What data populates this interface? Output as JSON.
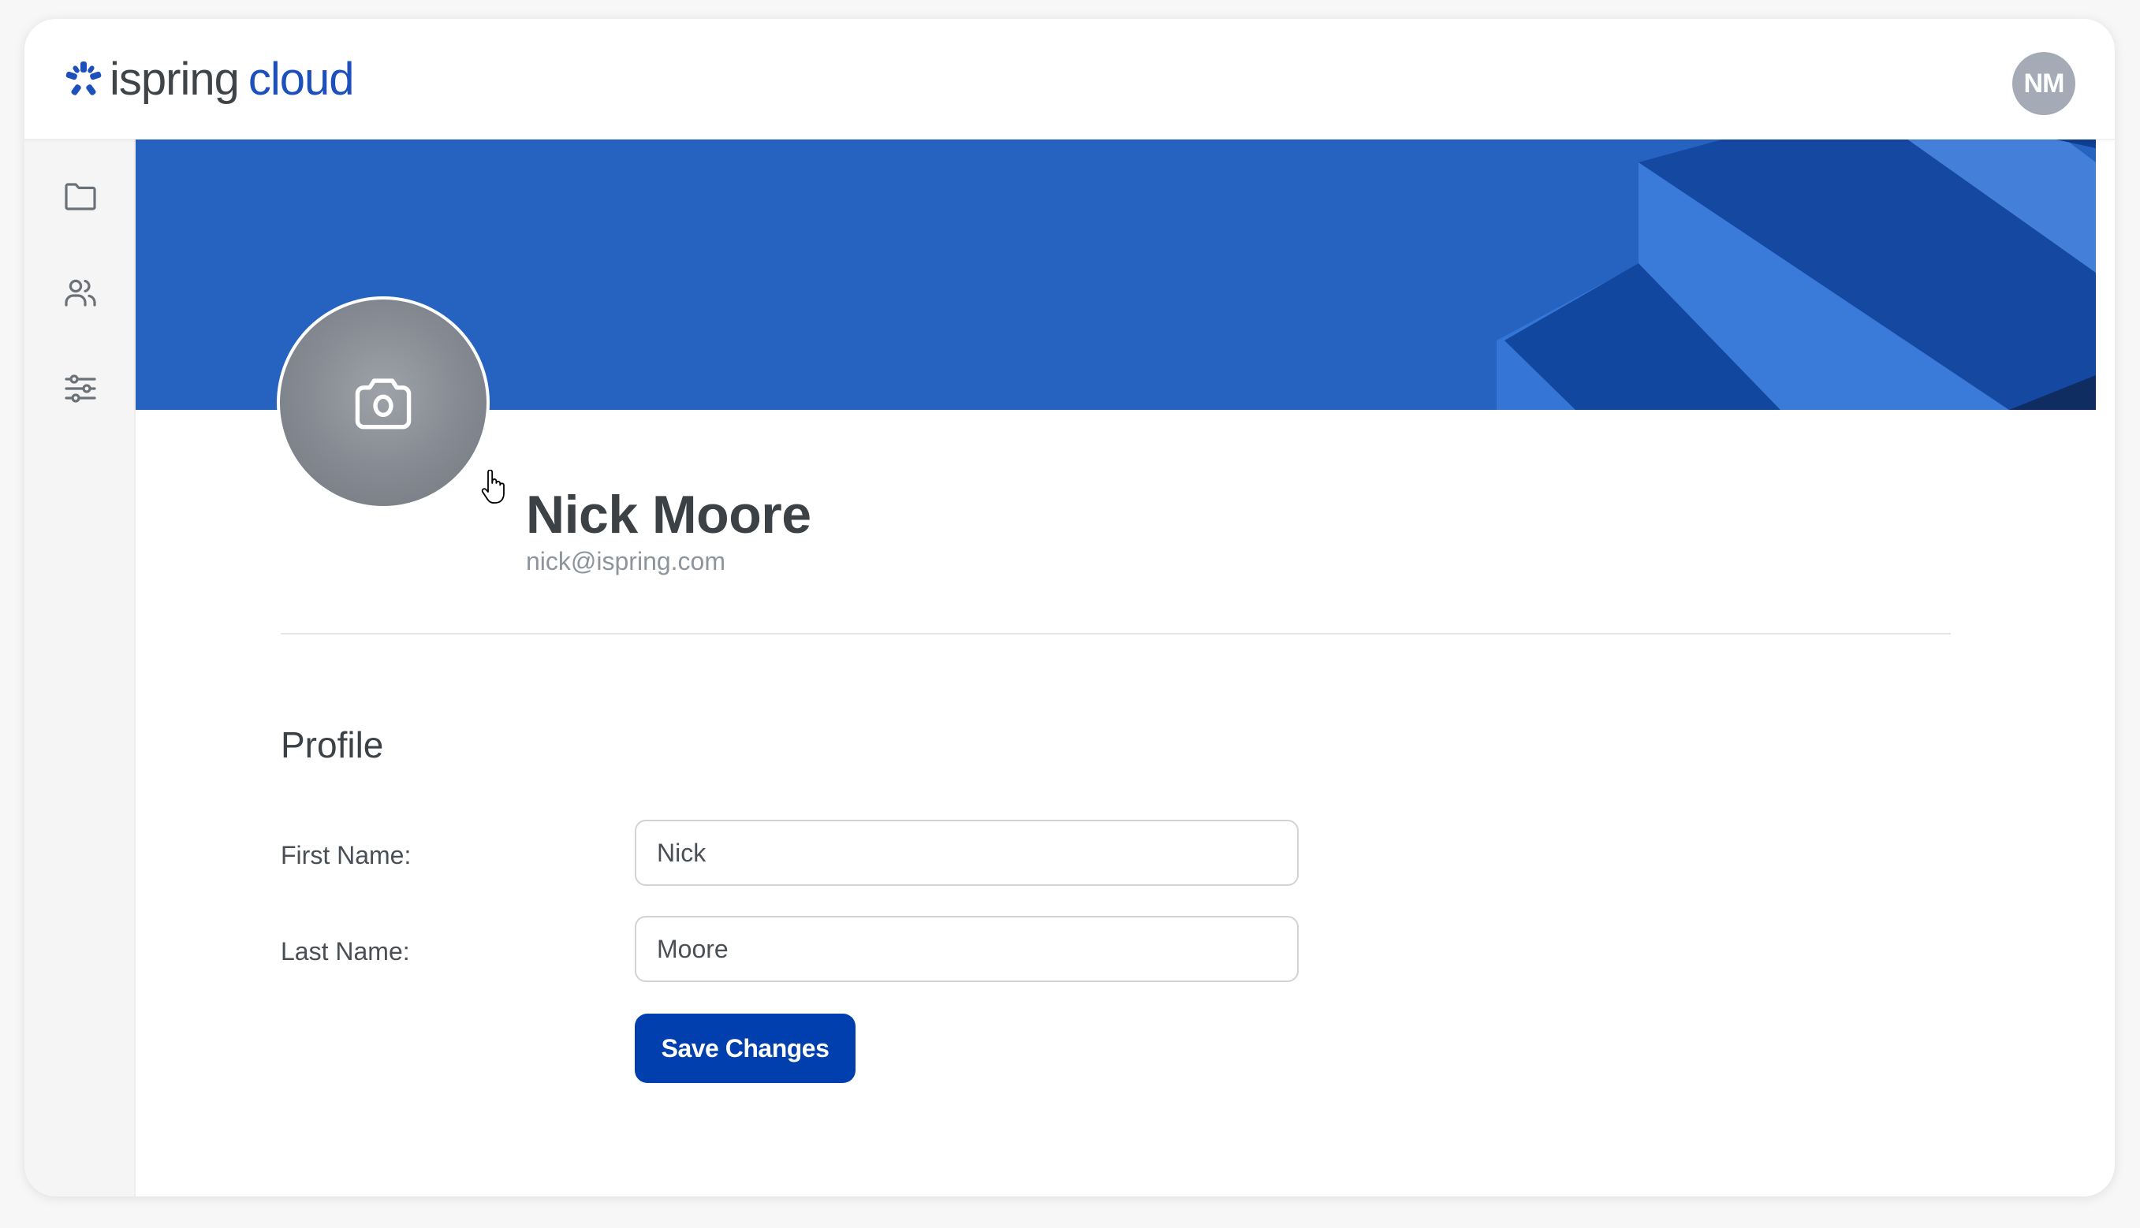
{
  "header": {
    "logo": {
      "primary": "ispring",
      "secondary": "cloud",
      "icon": "ispring-logo-icon"
    },
    "user_initials": "NM"
  },
  "sidebar": {
    "items": [
      {
        "id": "content",
        "icon": "folder-icon"
      },
      {
        "id": "users",
        "icon": "users-icon"
      },
      {
        "id": "settings",
        "icon": "sliders-icon"
      }
    ]
  },
  "profile_header": {
    "photo_icon": "camera-icon",
    "name": "Nick Moore",
    "email": "nick@ispring.com"
  },
  "profile_form": {
    "title": "Profile",
    "fields": [
      {
        "label": "First Name:",
        "value": "Nick"
      },
      {
        "label": "Last Name:",
        "value": "Moore"
      }
    ],
    "save_label": "Save Changes"
  },
  "colors": {
    "brand_blue": "#1d4fbd",
    "banner_blue": "#2662c0",
    "button_blue": "#023fae",
    "avatar_gray": "#a4abb6"
  }
}
